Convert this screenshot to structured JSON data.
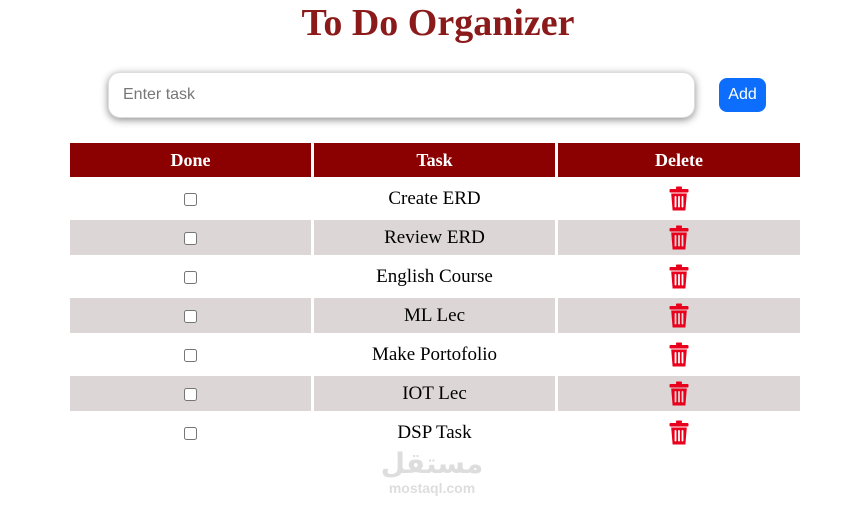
{
  "app": {
    "title": "To Do Organizer"
  },
  "task_input": {
    "value": "",
    "placeholder": "Enter task"
  },
  "add_button": {
    "label": "Add"
  },
  "table": {
    "headers": {
      "done": "Done",
      "task": "Task",
      "delete": "Delete"
    },
    "rows": [
      {
        "task": "Create ERD",
        "done": false
      },
      {
        "task": "Review ERD",
        "done": false
      },
      {
        "task": "English Course",
        "done": false
      },
      {
        "task": "ML Lec",
        "done": false
      },
      {
        "task": "Make Portofolio",
        "done": false
      },
      {
        "task": "IOT Lec",
        "done": false
      },
      {
        "task": "DSP Task",
        "done": false
      }
    ]
  },
  "icons": {
    "delete": "trash-icon"
  },
  "colors": {
    "title": "#8b1a1a",
    "header_bg": "#8b0000",
    "stripe_bg": "#dcd6d6",
    "add_button_bg": "#0d6efd",
    "trash_icon": "#e8001c"
  },
  "watermark": {
    "logo_text": "مستقل",
    "domain": "mostaql.com"
  }
}
